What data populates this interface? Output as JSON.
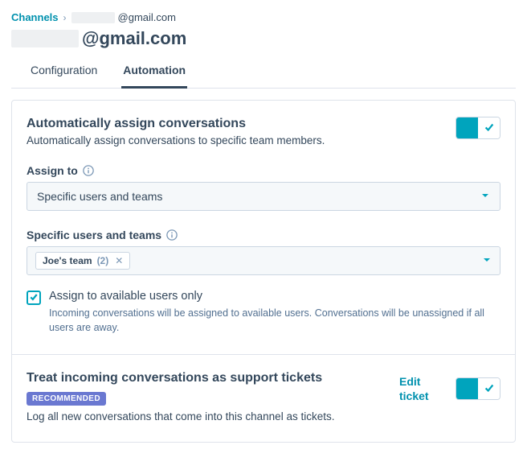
{
  "breadcrumb": {
    "root": "Channels",
    "email_suffix": "@gmail.com"
  },
  "page": {
    "title_suffix": "@gmail.com"
  },
  "tabs": {
    "configuration": "Configuration",
    "automation": "Automation"
  },
  "auto_assign": {
    "title": "Automatically assign conversations",
    "desc": "Automatically assign conversations to specific team members.",
    "assign_to_label": "Assign to",
    "assign_to_value": "Specific users and teams",
    "specific_label": "Specific users and teams",
    "chip_name": "Joe's team",
    "chip_count": "(2)",
    "avail_label": "Assign to available users only",
    "avail_help": "Incoming conversations will be assigned to available users. Conversations will be unassigned if all users are away."
  },
  "tickets": {
    "title": "Treat incoming conversations as support tickets",
    "badge": "RECOMMENDED",
    "desc": "Log all new conversations that come into this channel as tickets.",
    "edit_link": "Edit ticket"
  }
}
